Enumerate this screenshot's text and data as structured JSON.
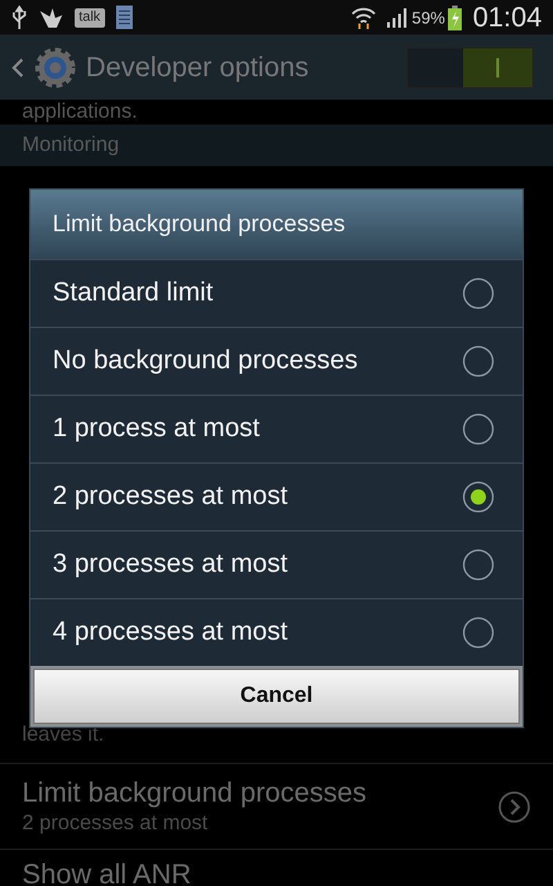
{
  "status_bar": {
    "talk_label": "talk",
    "battery_percent": "59%",
    "time": "01:04"
  },
  "header": {
    "title": "Developer options",
    "switch": {
      "on": true
    }
  },
  "background": {
    "cut_text": "applications.",
    "section": "Monitoring",
    "partial_text": "leaves it.",
    "rows": [
      {
        "title": "Limit background processes",
        "summary": "2 processes at most"
      }
    ],
    "cut_title": "Show all ANR"
  },
  "dialog": {
    "title": "Limit background processes",
    "options": [
      {
        "label": "Standard limit",
        "selected": false
      },
      {
        "label": "No background processes",
        "selected": false
      },
      {
        "label": "1 process at most",
        "selected": false
      },
      {
        "label": "2 processes at most",
        "selected": true
      },
      {
        "label": "3 processes at most",
        "selected": false
      },
      {
        "label": "4 processes at most",
        "selected": false
      }
    ],
    "cancel": "Cancel"
  }
}
